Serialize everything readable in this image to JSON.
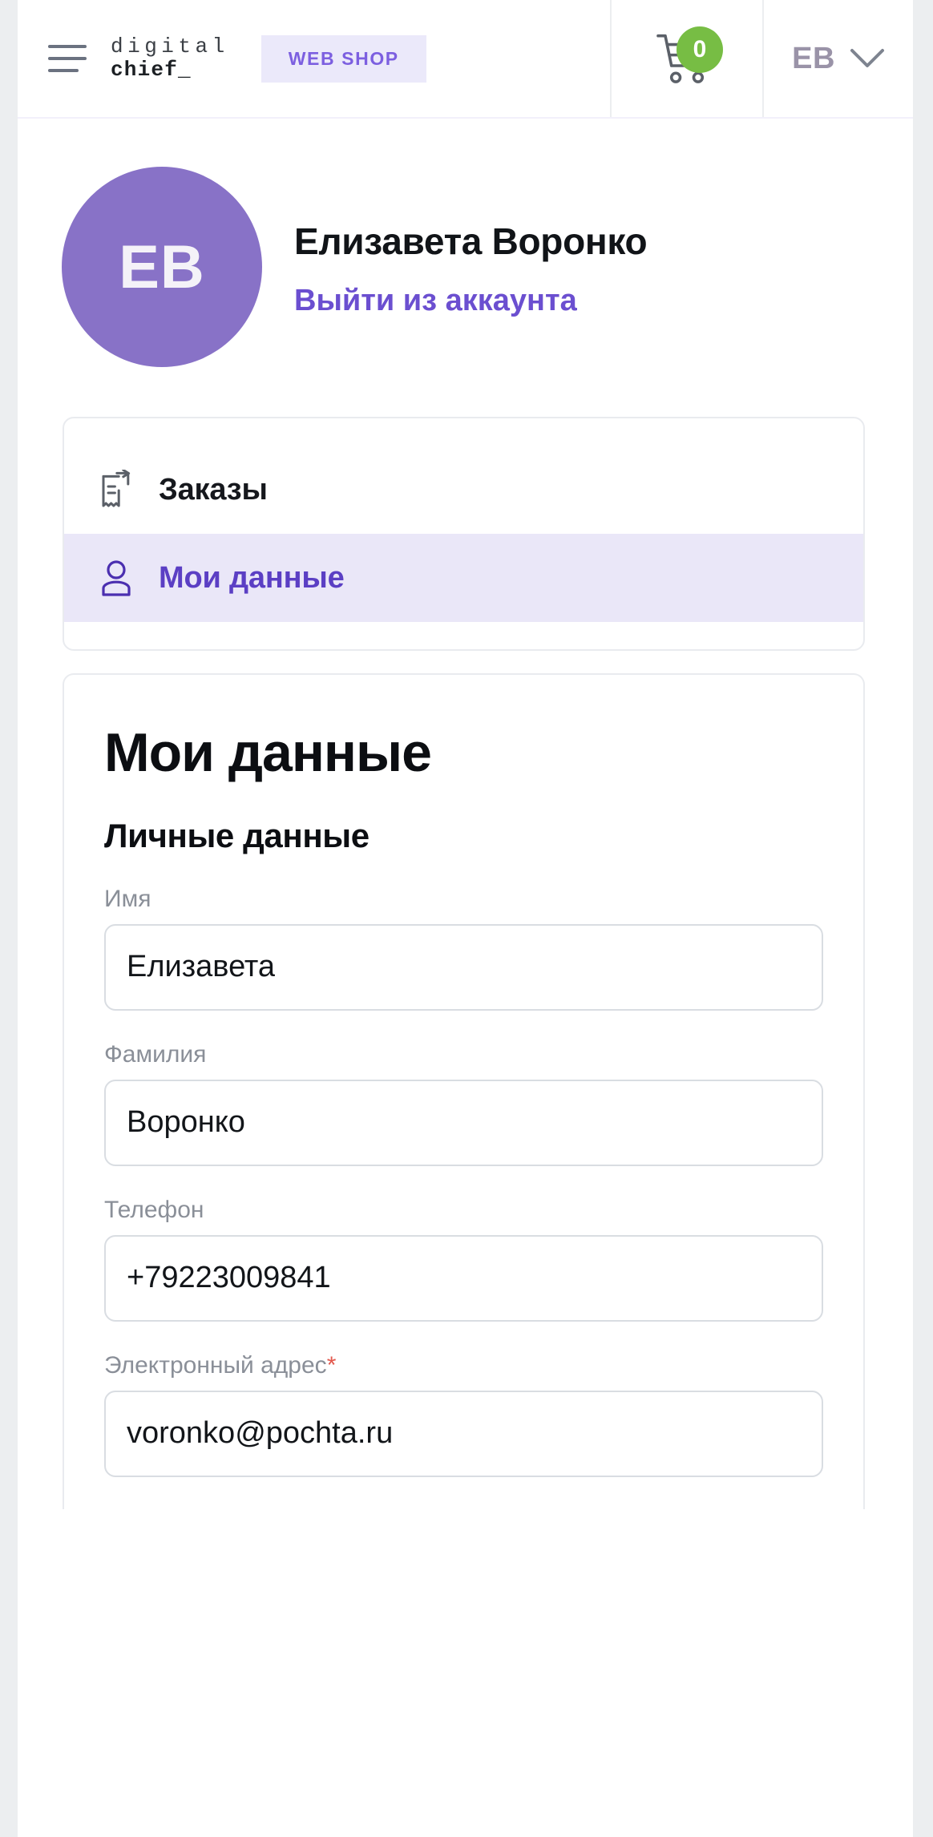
{
  "header": {
    "menu_icon": "hamburger-menu-icon",
    "logo_top": "digital",
    "logo_bottom": "chief_",
    "webshop_label": "WEB SHOP",
    "cart_icon": "shopping-cart-icon",
    "cart_count": "0",
    "cart_badge_color": "#77bd44",
    "user_initials": "ЕВ",
    "chevron_icon": "chevron-down-icon"
  },
  "profile": {
    "avatar_initials": "ЕВ",
    "avatar_color": "#8872c7",
    "name": "Елизавета Воронко",
    "logout_label": "Выйти из аккаунта",
    "logout_color": "#6b4fd0"
  },
  "nav": {
    "items": [
      {
        "label": "Заказы",
        "icon": "receipt-order-icon",
        "active": false
      },
      {
        "label": "Мои данные",
        "icon": "user-person-icon",
        "active": true
      }
    ],
    "active_bg": "#eae7f8",
    "active_color": "#5b3fc4"
  },
  "main": {
    "title": "Мои данные",
    "section_title": "Личные данные",
    "fields": [
      {
        "label": "Имя",
        "required": "",
        "value": "Елизавета",
        "placeholder": "Имя"
      },
      {
        "label": "Фамилия",
        "required": "",
        "value": "Воронко",
        "placeholder": "Фамилия"
      },
      {
        "label": "Телефон",
        "required": "",
        "value": "+79223009841",
        "placeholder": "Телефон"
      },
      {
        "label": "Электронный адрес",
        "required": "*",
        "value": "voronko@pochta.ru",
        "placeholder": "Электронный адрес"
      }
    ]
  }
}
